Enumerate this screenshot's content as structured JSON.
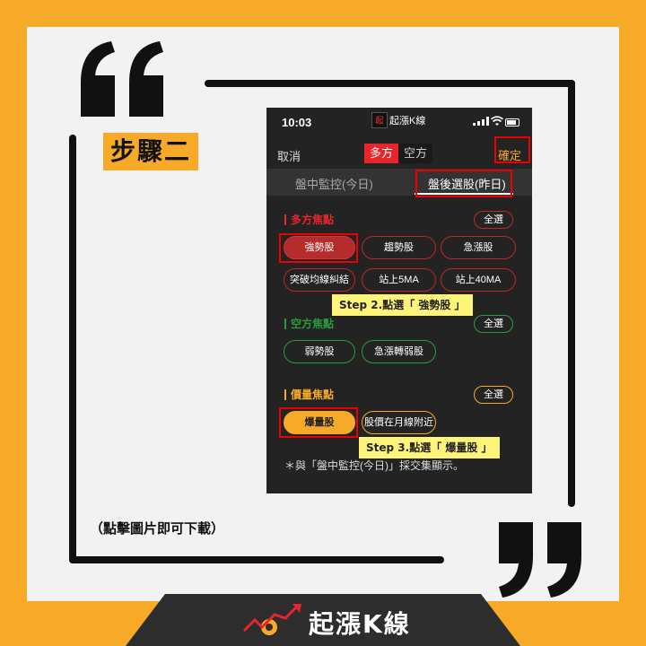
{
  "step_title": "步驟二",
  "download_note": "（點擊圖片即可下載）",
  "brand": {
    "name": "起漲K線"
  },
  "phone": {
    "status": {
      "time": "10:03",
      "app_icon_text": "起",
      "app_name": "起漲K線"
    },
    "header": {
      "cancel": "取消",
      "long_label": "多方",
      "short_label": "空方",
      "confirm": "確定"
    },
    "tabs": {
      "today": "盤中監控(今日)",
      "after": "盤後選股(昨日)"
    },
    "sections": {
      "long": {
        "title": "多方焦點",
        "select_all": "全選",
        "chips": [
          "強勢股",
          "趨勢股",
          "急漲股",
          "突破均線糾結",
          "站上5MA",
          "站上40MA"
        ]
      },
      "short": {
        "title": "空方焦點",
        "select_all": "全選",
        "chips": [
          "弱勢股",
          "急漲轉弱股"
        ]
      },
      "volume": {
        "title": "價量焦點",
        "select_all": "全選",
        "chips": [
          "爆量股",
          "股價在月線附近"
        ]
      }
    },
    "note": "＊與「盤中監控(今日)」採交集顯示。"
  },
  "callouts": {
    "step2": "Step 2.點選「 強勢股 」",
    "step3": "Step 3.點選「 爆量股 」"
  },
  "colors": {
    "accent": "#f7a928",
    "long": "#e8252b",
    "short": "#2a9c3c",
    "highlight": "#e00000"
  }
}
